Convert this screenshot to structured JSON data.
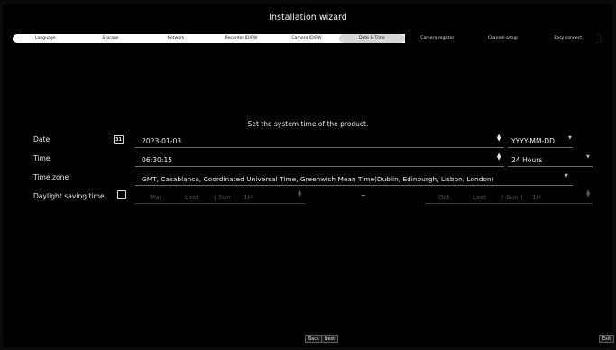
{
  "window": {
    "title": "Installation wizard"
  },
  "steps": [
    {
      "label": "Language",
      "state": "done"
    },
    {
      "label": "Storage",
      "state": "done"
    },
    {
      "label": "Network",
      "state": "done"
    },
    {
      "label": "Recorder ID/PW",
      "state": "done"
    },
    {
      "label": "Camera ID/PW",
      "state": "done"
    },
    {
      "label": "Date & Time",
      "state": "active"
    },
    {
      "label": "Camera register",
      "state": "future"
    },
    {
      "label": "Channel setup",
      "state": "future"
    },
    {
      "label": "Easy connect",
      "state": "future"
    }
  ],
  "subtitle": "Set the system time of the product.",
  "date": {
    "label": "Date",
    "calendar_icon_text": "31",
    "value": "2023-01-03",
    "format": "YYYY-MM-DD"
  },
  "time": {
    "label": "Time",
    "value": "06:30:15",
    "format": "24 Hours"
  },
  "timezone": {
    "label": "Time zone",
    "value": "GMT, Casablanca, Coordinated Universal Time, Greenwich Mean Time(Dublin, Edinburgh, Lisbon, London)"
  },
  "dst": {
    "label": "Daylight saving time",
    "checked": false,
    "start": {
      "month": "Mar",
      "week": "Last",
      "day": "( Sun )",
      "hour": "1H"
    },
    "separator": "~",
    "end": {
      "month": "Oct",
      "week": "Last",
      "day": "( Sun )",
      "hour": "1H"
    }
  },
  "buttons": {
    "back": "Back",
    "next": "Next",
    "exit": "Exit"
  },
  "colors": {
    "background": "#000000",
    "text": "#e8e8e8",
    "active_step": "#d7d7d7",
    "disabled_text": "#4e4e4e"
  }
}
